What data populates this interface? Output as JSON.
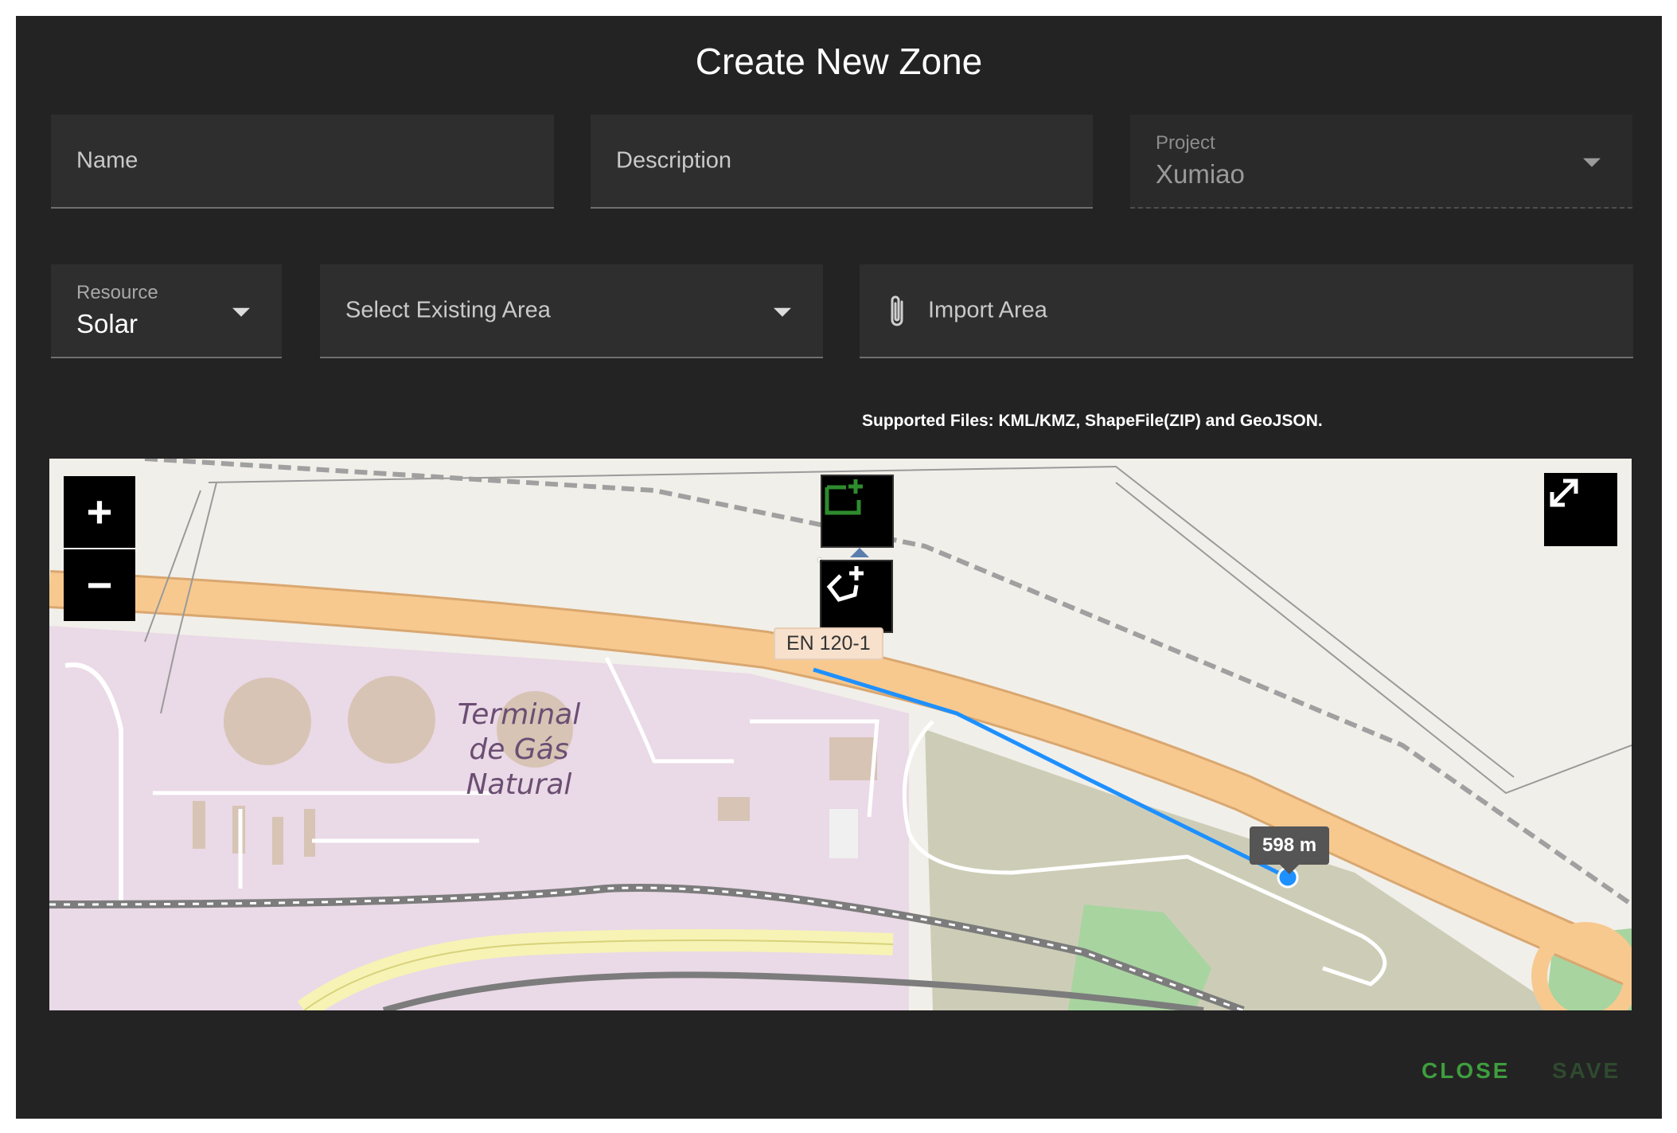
{
  "dialog": {
    "title": "Create New Zone"
  },
  "form": {
    "name_placeholder": "Name",
    "description_placeholder": "Description",
    "project": {
      "label": "Project",
      "value": "Xumiao"
    },
    "resource": {
      "label": "Resource",
      "value": "Solar"
    },
    "existing_area_placeholder": "Select Existing Area",
    "import_area_label": "Import Area",
    "supported_files_hint": "Supported Files: KML/KMZ, ShapeFile(ZIP) and GeoJSON."
  },
  "map": {
    "zoom_in": "+",
    "zoom_out": "−",
    "road_label": "EN 120-1",
    "place_label_line1": "Terminal",
    "place_label_line2": "de Gás",
    "place_label_line3": "Natural",
    "measure_tooltip": "598 m",
    "icons": [
      "draw-rectangle-icon",
      "draw-polyline-icon",
      "draw-polygon-icon",
      "fullscreen-icon",
      "paperclip-icon"
    ],
    "colors": {
      "draw_active": "#2e8b2e",
      "measure_line": "#1e90ff",
      "road": "#f7c98f",
      "industrial": "#ead9e6"
    }
  },
  "footer": {
    "close_label": "CLOSE",
    "save_label": "SAVE"
  }
}
